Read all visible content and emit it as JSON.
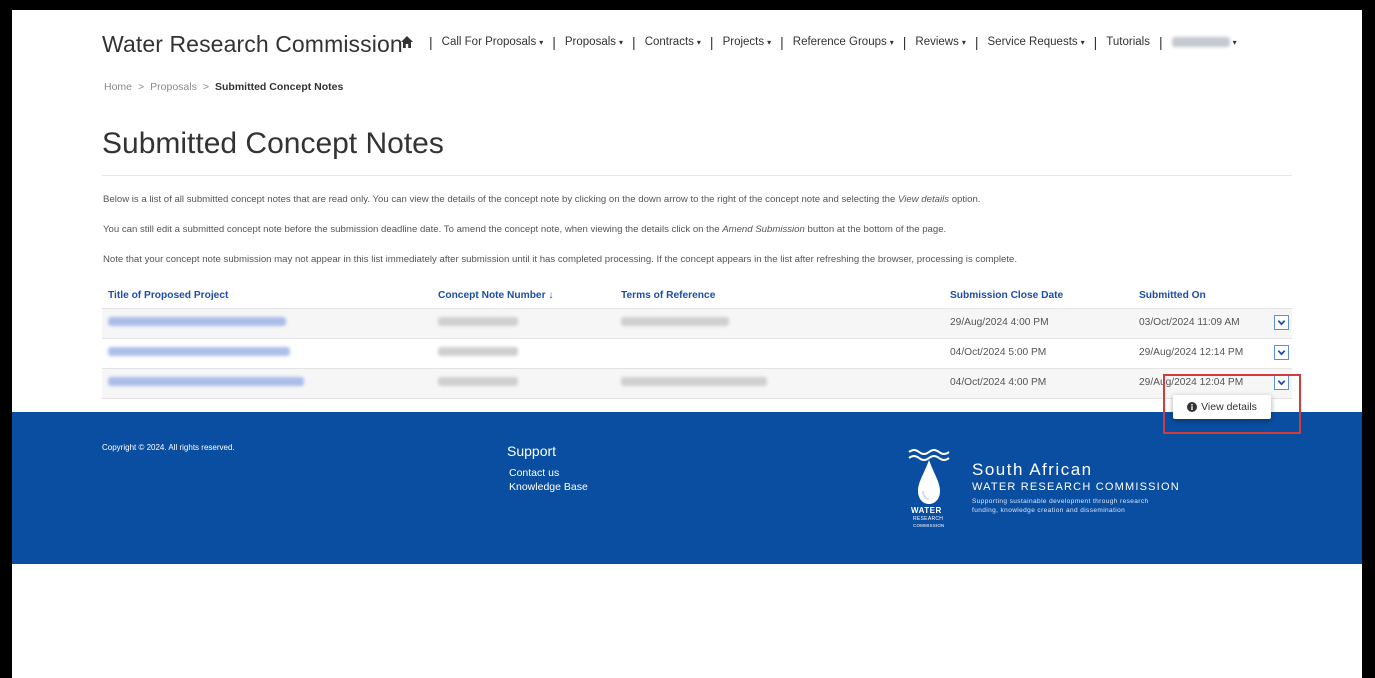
{
  "header": {
    "brand": "Water Research Commission",
    "nav": [
      {
        "label": "Call For Proposals",
        "caret": "▾"
      },
      {
        "label": "Proposals",
        "caret": "▾"
      },
      {
        "label": "Contracts",
        "caret": "▾"
      },
      {
        "label": "Projects",
        "caret": "▾"
      },
      {
        "label": "Reference Groups",
        "caret": "▾"
      },
      {
        "label": "Reviews",
        "caret": "▾"
      },
      {
        "label": "Service Requests",
        "caret": "▾"
      },
      {
        "label": "Tutorials"
      }
    ],
    "user_caret": "▾",
    "separator": "|"
  },
  "breadcrumb": {
    "home": "Home",
    "proposals": "Proposals",
    "current": "Submitted Concept Notes",
    "separator": ">"
  },
  "page": {
    "title": "Submitted Concept Notes",
    "para1": "Below is a list of all submitted concept notes that are read only.  You can view the details of the concept note by clicking on the down arrow to the right of the concept note and selecting the ",
    "para1_em": "View details",
    "para1_end": " option.",
    "para2": "You can still edit a submitted concept note before the submission deadline date. To amend the concept note, when viewing the details click on the ",
    "para2_em": "Amend Submission",
    "para2_end": " button at the bottom of the page.",
    "para3": "Note that your concept note submission may not appear in this list immediately after submission until it has completed processing. If the concept appears in the list after refreshing the browser, processing is complete."
  },
  "table": {
    "columns": {
      "title": "Title of Proposed Project",
      "number": "Concept Note Number",
      "sort_arrow": "↓",
      "terms": "Terms of Reference",
      "close_date": "Submission Close Date",
      "submitted_on": "Submitted On"
    },
    "rows": [
      {
        "close_date": "29/Aug/2024 4:00 PM",
        "submitted_on": "03/Oct/2024 11:09 AM"
      },
      {
        "close_date": "04/Oct/2024 5:00 PM",
        "submitted_on": "29/Aug/2024 12:14 PM"
      },
      {
        "close_date": "04/Oct/2024 4:00 PM",
        "submitted_on": "29/Aug/2024 12:04 PM"
      }
    ]
  },
  "dropdown": {
    "view_details": "View details"
  },
  "footer": {
    "copyright": "Copyright © 2024. All rights reserved.",
    "support_title": "Support",
    "contact": "Contact us",
    "knowledge": "Knowledge Base",
    "logo_line1": "South African",
    "logo_line2": "WATER RESEARCH COMMISSION",
    "logo_tag1": "Supporting sustainable development through research",
    "logo_tag2": "funding, knowledge creation and dissemination",
    "logo_water": "WATER",
    "logo_research": "RESEARCH",
    "logo_commission": "COMMISSION"
  },
  "colors": {
    "link": "#1e4ea8",
    "footer": "#0a4ea2",
    "highlight": "#d23b3b"
  }
}
